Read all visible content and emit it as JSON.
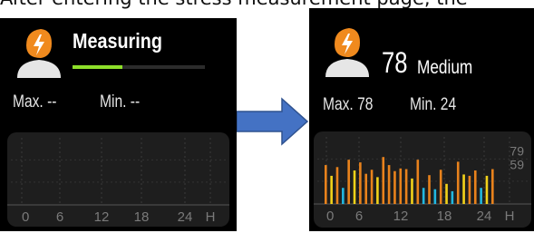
{
  "caption": "After entering the stress measurement page, the",
  "icons": {
    "avatar": "person-avatar-with-lightning-icon",
    "arrow": "right-arrow-icon"
  },
  "colors": {
    "screen_bg": "#000000",
    "panel_bg": "#1e1e1e",
    "avatar_head": "#f08a1e",
    "progress": "#8ee02a",
    "arrow_fill": "#4472c4",
    "bar_orange": "#e8821c",
    "bar_yellow": "#f2d21a",
    "bar_cyan": "#22b8e0"
  },
  "left_screen": {
    "status": "Measuring",
    "progress": 0.38,
    "max_label": "Max.",
    "max_value": "--",
    "min_label": "Min.",
    "min_value": "--",
    "x_ticks": [
      "0",
      "6",
      "12",
      "18",
      "24",
      "H"
    ]
  },
  "right_screen": {
    "value": "78",
    "level": "Medium",
    "max_label": "Max.",
    "max_value": "78",
    "min_label": "Min.",
    "min_value": "24",
    "x_ticks": [
      "0",
      "6",
      "12",
      "18",
      "24",
      "H"
    ],
    "y_ticks": [
      "79",
      "59"
    ]
  },
  "chart_data": {
    "type": "bar",
    "ylim": [
      0,
      100
    ],
    "y_ticks": [
      59,
      79
    ],
    "x_ticks": [
      "0",
      "6",
      "12",
      "18",
      "24",
      "H"
    ],
    "values": [
      58,
      42,
      55,
      24,
      66,
      50,
      62,
      45,
      51,
      40,
      70,
      58,
      49,
      53,
      52,
      38,
      66,
      24,
      43,
      22,
      51,
      30,
      19,
      63,
      44,
      42,
      50,
      24,
      42,
      52
    ],
    "level_colors": [
      "orange",
      "yellow",
      "orange",
      "cyan",
      "orange",
      "yellow",
      "orange",
      "orange",
      "orange",
      "yellow",
      "orange",
      "orange",
      "orange",
      "orange",
      "orange",
      "yellow",
      "orange",
      "cyan",
      "orange",
      "cyan",
      "orange",
      "yellow",
      "cyan",
      "orange",
      "yellow",
      "orange",
      "orange",
      "cyan",
      "yellow",
      "orange"
    ]
  }
}
